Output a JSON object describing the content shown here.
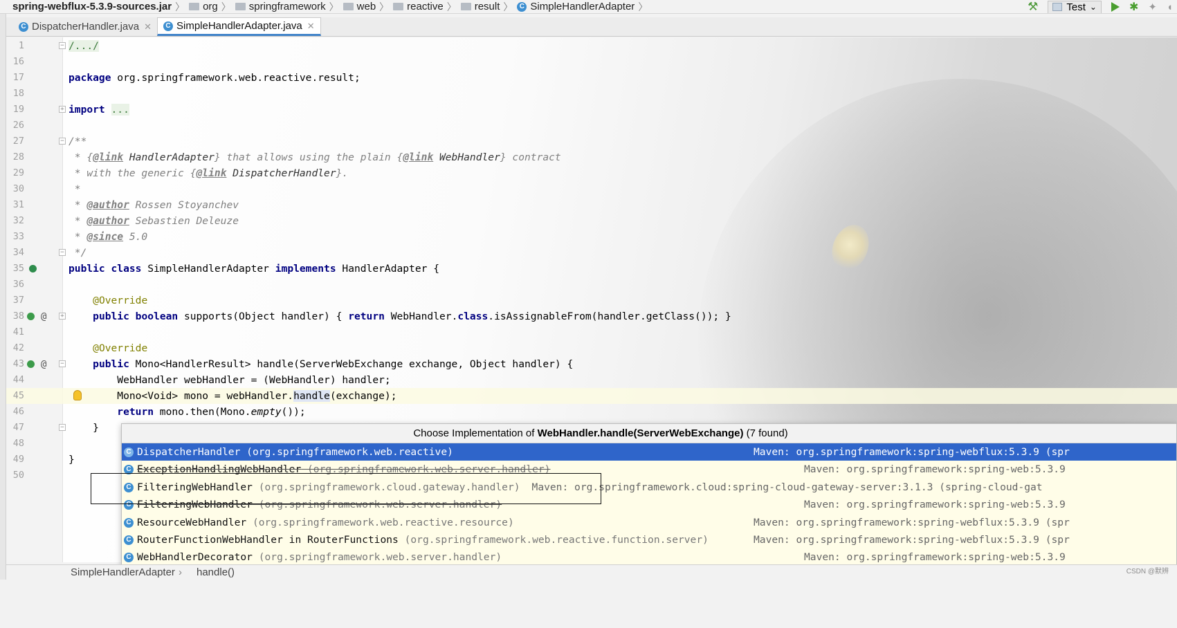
{
  "breadcrumb": {
    "jar": "spring-webflux-5.3.9-sources.jar",
    "folders": [
      "org",
      "springframework",
      "web",
      "reactive",
      "result"
    ],
    "file": "SimpleHandlerAdapter",
    "separator": "〉"
  },
  "toolbar": {
    "run_config": "Test"
  },
  "tabs": [
    {
      "label": "DispatcherHandler.java",
      "active": false
    },
    {
      "label": "SimpleHandlerAdapter.java",
      "active": true
    }
  ],
  "editor": {
    "lines": [
      {
        "n": "1"
      },
      {
        "n": "16"
      },
      {
        "n": "17"
      },
      {
        "n": "18"
      },
      {
        "n": "19"
      },
      {
        "n": "26"
      },
      {
        "n": "27"
      },
      {
        "n": "28"
      },
      {
        "n": "29"
      },
      {
        "n": "30"
      },
      {
        "n": "31"
      },
      {
        "n": "32"
      },
      {
        "n": "33"
      },
      {
        "n": "34"
      },
      {
        "n": "35"
      },
      {
        "n": "36"
      },
      {
        "n": "37"
      },
      {
        "n": "38"
      },
      {
        "n": "41"
      },
      {
        "n": "42"
      },
      {
        "n": "43"
      },
      {
        "n": "44"
      },
      {
        "n": "45"
      },
      {
        "n": "46"
      },
      {
        "n": "47"
      },
      {
        "n": "48"
      },
      {
        "n": "49"
      },
      {
        "n": "50"
      }
    ],
    "t": {
      "l1": "/.../",
      "pkg_kw": "package",
      "pkg_name": " org.springframework.web.reactive.result;",
      "imp_kw": "import",
      "imp_dots": "...",
      "doc_open": "/**",
      "d28_a": " * {",
      "d28_tag1": "@link",
      "d28_ref1": " HandlerAdapter",
      "d28_b": "} that allows using the plain {",
      "d28_tag2": "@link",
      "d28_ref2": " WebHandler",
      "d28_c": "} contract",
      "d29_a": " * with the generic {",
      "d29_tag": "@link",
      "d29_ref": " DispatcherHandler",
      "d29_b": "}.",
      "d30": " *",
      "d31_a": " * ",
      "d31_tag": "@author",
      "d31_b": " Rossen Stoyanchev",
      "d32_a": " * ",
      "d32_tag": "@author",
      "d32_b": " Sebastien Deleuze",
      "d33_a": " * ",
      "d33_tag": "@since",
      "d33_b": " 5.0",
      "d34": " */",
      "c35_kw1": "public",
      "c35_kw2": "class",
      "c35_name": " SimpleHandlerAdapter ",
      "c35_kw3": "implements",
      "c35_rest": " HandlerAdapter {",
      "ann": "@Override",
      "m38_kw1": "public",
      "m38_kw2": "boolean",
      "m38_a": " supports(Object handler) { ",
      "m38_kw3": "return",
      "m38_b": " WebHandler.",
      "m38_kw4": "class",
      "m38_c": ".isAssignableFrom(handler.getClass()); }",
      "m43_kw1": "public",
      "m43_rest": " Mono<HandlerResult> handle(ServerWebExchange exchange, Object handler) {",
      "l44": "WebHandler webHandler = (WebHandler) handler;",
      "l45_a": "Mono<Void> mono = webHandler.",
      "l45_hl": "handle",
      "l45_b": "(exchange);",
      "l46_kw": "return",
      "l46_a": " mono.then(Mono.",
      "l46_it": "empty",
      "l46_b": "());",
      "l47": "}",
      "l49": "}"
    }
  },
  "popup": {
    "title_prefix": "Choose Implementation of ",
    "title_method": "WebHandler.handle(ServerWebExchange)",
    "title_suffix": " (7 found)",
    "items": [
      {
        "name": "DispatcherHandler",
        "pkg": " (org.springframework.web.reactive)",
        "location": "Maven: org.springframework:spring-webflux:5.3.9 (spr",
        "selected": true,
        "strike": false,
        "inline": false
      },
      {
        "name": "ExceptionHandlingWebHandler",
        "pkg": " (org.springframework.web.server.handler)",
        "location": "Maven: org.springframework:spring-web:5.3.9",
        "selected": false,
        "strike": true,
        "inline": false
      },
      {
        "name": "FilteringWebHandler",
        "pkg": " (org.springframework.cloud.gateway.handler)",
        "location": "Maven: org.springframework.cloud:spring-cloud-gateway-server:3.1.3 (spring-cloud-gat",
        "selected": false,
        "strike": false,
        "inline": true
      },
      {
        "name": "FilteringWebHandler",
        "pkg": " (org.springframework.web.server.handler)",
        "location": "Maven: org.springframework:spring-web:5.3.9",
        "selected": false,
        "strike": true,
        "inline": false
      },
      {
        "name": "ResourceWebHandler",
        "pkg": " (org.springframework.web.reactive.resource)",
        "location": "Maven: org.springframework:spring-webflux:5.3.9 (spr",
        "selected": false,
        "strike": false,
        "inline": false
      },
      {
        "name": "RouterFunctionWebHandler in RouterFunctions",
        "pkg": " (org.springframework.web.reactive.function.server)",
        "location": "Maven: org.springframework:spring-webflux:5.3.9 (spr",
        "selected": false,
        "strike": false,
        "inline": false
      },
      {
        "name": "WebHandlerDecorator",
        "pkg": " (org.springframework.web.server.handler)",
        "location": "Maven: org.springframework:spring-web:5.3.9",
        "selected": false,
        "strike": false,
        "inline": false
      }
    ]
  },
  "status": {
    "class": "SimpleHandlerAdapter",
    "sep": "›",
    "method": "handle()"
  },
  "watermark": "CSDN @默辨"
}
